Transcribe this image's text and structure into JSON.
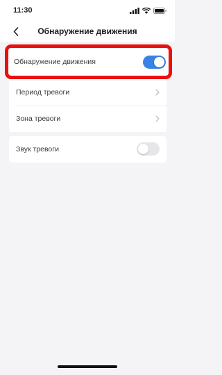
{
  "status_bar": {
    "time": "11:30"
  },
  "nav": {
    "title": "Обнаружение движения"
  },
  "motion_detection": {
    "label": "Обнаружение движения",
    "enabled": true
  },
  "alarm_settings": [
    {
      "label": "Период тревоги"
    },
    {
      "label": "Зона тревоги"
    }
  ],
  "alarm_sound": {
    "label": "Звук тревоги",
    "enabled": false
  },
  "colors": {
    "accent": "#3b82e6",
    "highlight": "#ea1010",
    "background": "#f4f4f6"
  }
}
